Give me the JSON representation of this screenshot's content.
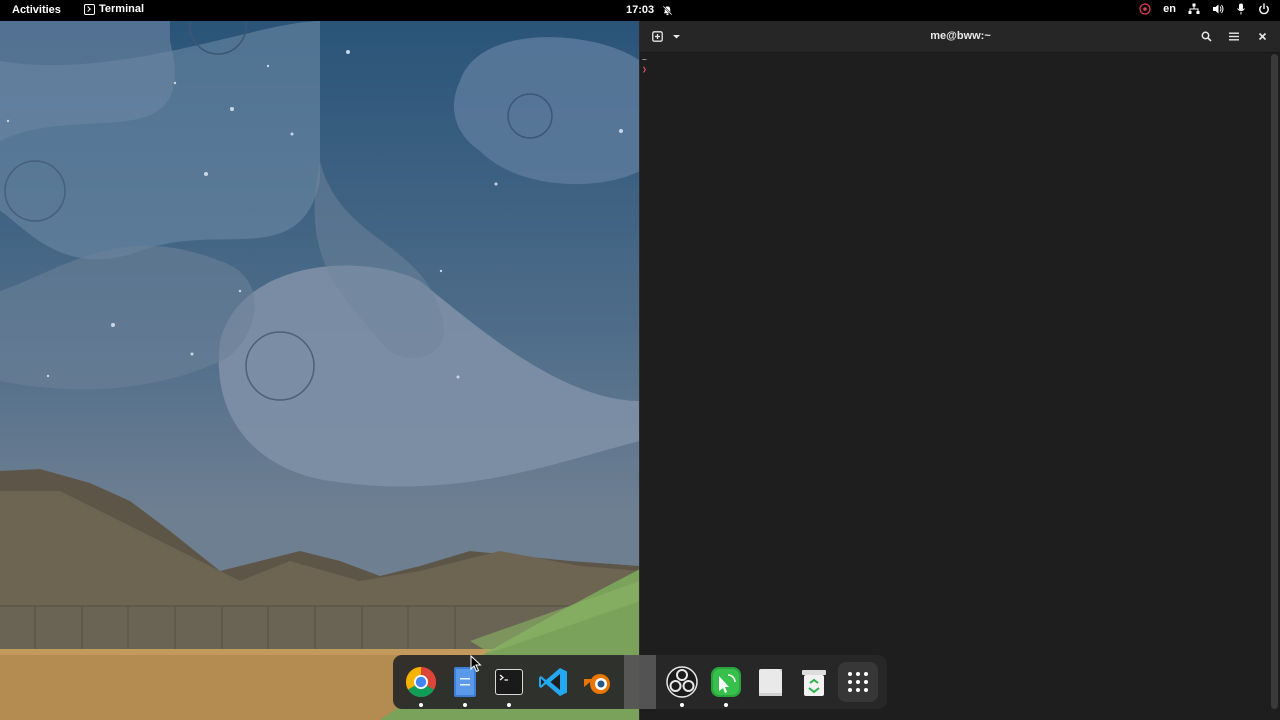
{
  "topbar": {
    "activities": "Activities",
    "app_name": "Terminal",
    "clock": "17:03",
    "language": "en",
    "icons": [
      "notifications-off-icon",
      "accessibility-icon",
      "network-icon",
      "volume-icon",
      "microphone-icon",
      "power-icon"
    ]
  },
  "terminal": {
    "title": "me@bww:~",
    "lines": [
      "~",
      "❯"
    ],
    "colors": {
      "background": "#1e1e1e",
      "header": "#262626",
      "prompt": "#e05a6a"
    }
  },
  "dock": {
    "apps": [
      {
        "name": "chrome-icon",
        "running": true
      },
      {
        "name": "files-icon",
        "running": true
      },
      {
        "name": "terminal-icon",
        "running": true
      },
      {
        "name": "vscode-icon",
        "running": false
      },
      {
        "name": "blender-icon",
        "running": false
      },
      {
        "name": "obs-icon",
        "running": true
      },
      {
        "name": "green-app-icon",
        "running": true
      },
      {
        "name": "text-editor-icon",
        "running": false
      },
      {
        "name": "trash-icon",
        "running": false
      },
      {
        "name": "show-apps-icon",
        "running": false
      }
    ]
  }
}
